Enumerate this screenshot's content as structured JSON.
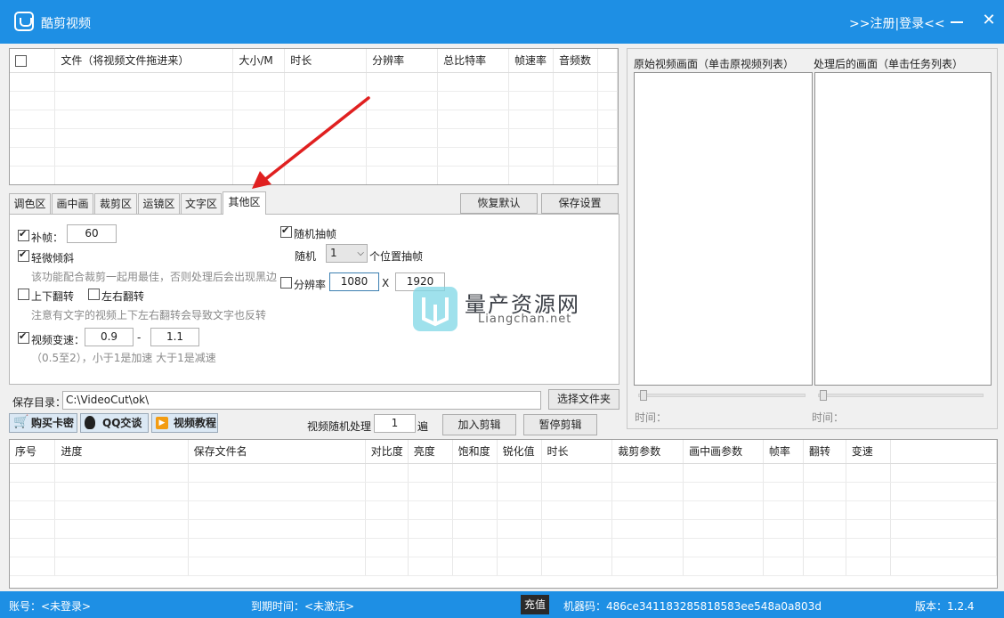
{
  "app": {
    "title": "酷剪视频",
    "register_login": ">>注册|登录<<",
    "close_icon": "✕"
  },
  "file_table": {
    "columns": [
      "",
      "文件（将视频文件拖进来）",
      "大小/M",
      "时长",
      "分辨率",
      "总比特率",
      "帧速率",
      "音频数"
    ],
    "row_count": 6
  },
  "tabs": [
    "调色区",
    "画中画",
    "裁剪区",
    "运镜区",
    "文字区",
    "其他区"
  ],
  "active_tab": "其他区",
  "buttons": {
    "restore_default": "恢复默认",
    "save_settings": "保存设置",
    "choose_folder": "选择文件夹",
    "add_edit": "加入剪辑",
    "pause_edit": "暂停剪辑",
    "buy_card": "购买卡密",
    "qq_chat": "QQ交谈",
    "video_tutorial": "视频教程"
  },
  "other_tab": {
    "frame_fill_label": "补帧：",
    "frame_fill_value": "60",
    "frame_fill_checked": true,
    "slight_tilt_label": "轻微倾斜",
    "slight_tilt_checked": true,
    "slight_tilt_hint": "该功能配合裁剪一起用最佳，否则处理后会出现黑边",
    "flip_vertical_label": "上下翻转",
    "flip_vertical_checked": false,
    "flip_horizontal_label": "左右翻转",
    "flip_horizontal_checked": false,
    "flip_hint": "注意有文字的视频上下左右翻转会导致文字也反转",
    "speed_label": "视频变速：",
    "speed_checked": true,
    "speed_min": "0.9",
    "speed_sep": "-",
    "speed_max": "1.1",
    "speed_hint": "（0.5至2），小于1是加速 大于1是减速",
    "random_drop_label": "随机抽帧",
    "random_drop_checked": true,
    "random_prefix": "随机",
    "random_select_value": "1",
    "random_suffix": "个位置抽帧",
    "resolution_label": "分辨率",
    "resolution_checked": false,
    "resolution_width": "1080",
    "resolution_x": "X",
    "resolution_height": "1920"
  },
  "save_dir": {
    "label": "保存目录：",
    "value": "C:\\VideoCut\\ok\\"
  },
  "random_process": {
    "label": "视频随机处理",
    "value": "1",
    "unit": "遍"
  },
  "preview": {
    "original_label": "原始视频画面（单击原视频列表）",
    "processed_label": "处理后的画面（单击任务列表）",
    "time_label": "时间："
  },
  "task_table": {
    "columns": [
      "序号",
      "进度",
      "保存文件名",
      "对比度",
      "亮度",
      "饱和度",
      "锐化值",
      "时长",
      "裁剪参数",
      "画中画参数",
      "帧率",
      "翻转",
      "变速",
      ""
    ],
    "row_count": 6
  },
  "status": {
    "account": "账号：<未登录>",
    "expire": "到期时间：<未激活>",
    "recharge": "充值",
    "machine_code": "机器码：486ce341183285818583ee548a0a803d",
    "version": "版本：1.2.4"
  },
  "watermark": {
    "title": "量产资源网",
    "subtitle": "Liangchan.net"
  },
  "colors": {
    "titlebar": "#1e8fe4",
    "arrow": "#e02020"
  }
}
